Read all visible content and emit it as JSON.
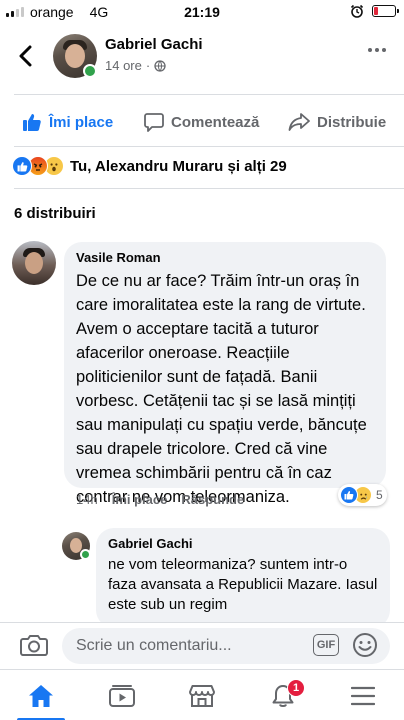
{
  "status_bar": {
    "carrier": "orange",
    "network": "4G",
    "time": "21:19"
  },
  "post": {
    "author": "Gabriel Gachi",
    "time": "14 ore",
    "privacy_icon": "globe-icon",
    "actions": {
      "like": "Îmi place",
      "comment": "Comentează",
      "share": "Distribuie"
    },
    "reactions_summary": "Tu, Alexandru Muraru și alți 29",
    "shares": "6 distribuiri"
  },
  "comments": [
    {
      "author": "Vasile Roman",
      "text": "De ce nu ar face? Trăim într-un oraș în care imoralitatea este la rang de virtute. Avem o acceptare tacită a tuturor afacerilor oneroase. Reacțiile politicienilor sunt de fațadă. Banii vorbesc. Cetățenii tac și se lasă mințiți sau manipulați cu spațiu verde, băncuțe sau drapele tricolore. Cred că vine vremea schimbării pentru că în caz contrar ne vom teleormaniza.",
      "time": "14h",
      "like_label": "Îmi place",
      "reply_label": "Răspunde",
      "reaction_count": "5"
    }
  ],
  "reply": {
    "author": "Gabriel Gachi",
    "text": "ne vom teleormaniza? suntem intr-o faza avansata a Republicii Mazare. Iasul este sub un regim"
  },
  "composer": {
    "placeholder": "Scrie un comentariu...",
    "gif_label": "GIF"
  },
  "tabbar": {
    "notifications_badge": "1",
    "active_tab": "home"
  },
  "colors": {
    "accent": "#1877f2",
    "online": "#31a24c",
    "badge": "#e41e3f",
    "battery": "#e0283b"
  }
}
